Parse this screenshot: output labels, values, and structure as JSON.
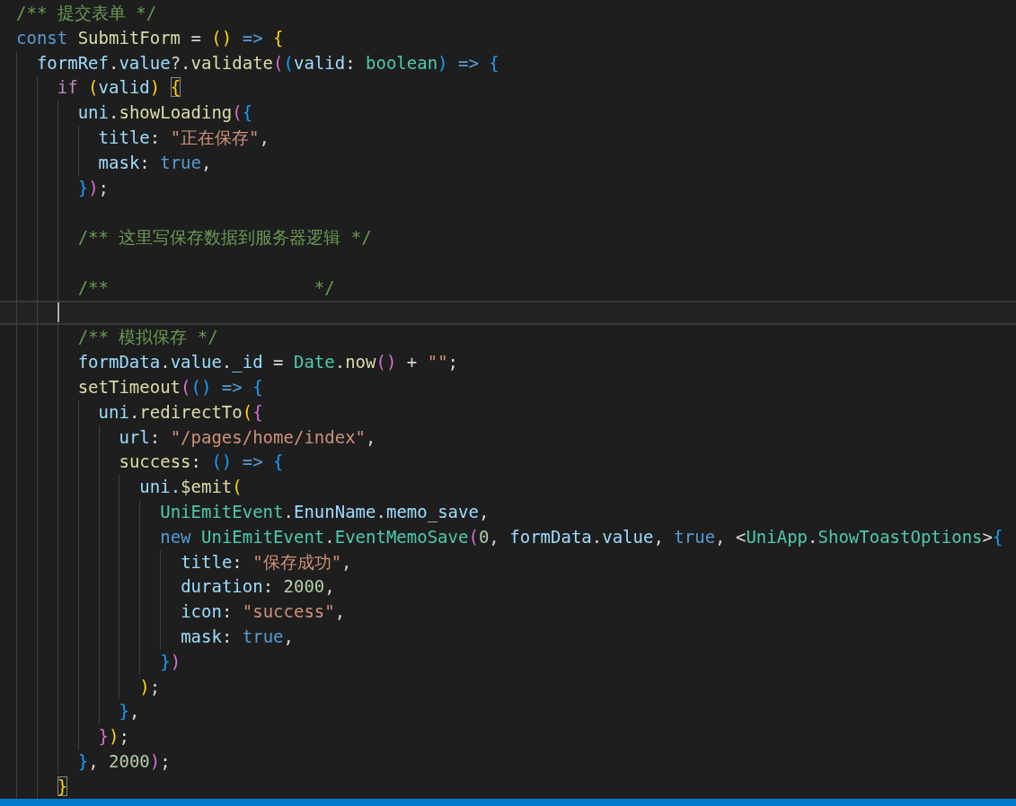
{
  "lines": [
    {
      "current": false,
      "tokens": [
        {
          "text": "/** 提交表单 */",
          "kind": "comment"
        }
      ]
    },
    {
      "current": false,
      "tokens": [
        {
          "text": "const ",
          "kind": "keyword"
        },
        {
          "text": "SubmitForm",
          "kind": "function"
        },
        {
          "text": " = ",
          "kind": "plain"
        },
        {
          "text": "()",
          "kind": "brace1"
        },
        {
          "text": " => ",
          "kind": "keyword"
        },
        {
          "text": "{",
          "kind": "brace1"
        }
      ]
    },
    {
      "current": false,
      "tokens": [
        {
          "text": "  formRef",
          "kind": "variable"
        },
        {
          "text": ".",
          "kind": "plain"
        },
        {
          "text": "value",
          "kind": "variable"
        },
        {
          "text": "?.",
          "kind": "plain"
        },
        {
          "text": "validate",
          "kind": "function"
        },
        {
          "text": "(",
          "kind": "brace2"
        },
        {
          "text": "(",
          "kind": "brace3"
        },
        {
          "text": "valid",
          "kind": "variable"
        },
        {
          "text": ": ",
          "kind": "plain"
        },
        {
          "text": "boolean",
          "kind": "type"
        },
        {
          "text": ")",
          "kind": "brace3"
        },
        {
          "text": " => ",
          "kind": "keyword"
        },
        {
          "text": "{",
          "kind": "brace3"
        }
      ]
    },
    {
      "current": false,
      "tokens": [
        {
          "text": "    if ",
          "kind": "control"
        },
        {
          "text": "(",
          "kind": "brace1"
        },
        {
          "text": "valid",
          "kind": "variable"
        },
        {
          "text": ") ",
          "kind": "brace1"
        },
        {
          "text": "{",
          "kind": "brace1",
          "matched": true
        }
      ]
    },
    {
      "current": false,
      "tokens": [
        {
          "text": "      uni",
          "kind": "variable"
        },
        {
          "text": ".",
          "kind": "plain"
        },
        {
          "text": "showLoading",
          "kind": "function"
        },
        {
          "text": "(",
          "kind": "brace2"
        },
        {
          "text": "{",
          "kind": "brace3"
        }
      ]
    },
    {
      "current": false,
      "tokens": [
        {
          "text": "        title",
          "kind": "variable"
        },
        {
          "text": ": ",
          "kind": "plain"
        },
        {
          "text": "\"正在保存\"",
          "kind": "string"
        },
        {
          "text": ",",
          "kind": "plain"
        }
      ]
    },
    {
      "current": false,
      "tokens": [
        {
          "text": "        mask",
          "kind": "variable"
        },
        {
          "text": ": ",
          "kind": "plain"
        },
        {
          "text": "true",
          "kind": "keyword"
        },
        {
          "text": ",",
          "kind": "plain"
        }
      ]
    },
    {
      "current": false,
      "tokens": [
        {
          "text": "      }",
          "kind": "brace3"
        },
        {
          "text": ")",
          "kind": "brace2"
        },
        {
          "text": ";",
          "kind": "plain"
        }
      ]
    },
    {
      "current": false
    },
    {
      "current": false,
      "tokens": [
        {
          "text": "      /** 这里写保存数据到服务器逻辑 */",
          "kind": "comment"
        }
      ]
    },
    {
      "current": false
    },
    {
      "current": false,
      "tokens": [
        {
          "text": "      /**                    */",
          "kind": "comment"
        }
      ]
    },
    {
      "current": true
    },
    {
      "current": false,
      "tokens": [
        {
          "text": "      /** 模拟保存 */",
          "kind": "comment"
        }
      ]
    },
    {
      "current": false,
      "tokens": [
        {
          "text": "      formData",
          "kind": "variable"
        },
        {
          "text": ".",
          "kind": "plain"
        },
        {
          "text": "value",
          "kind": "variable"
        },
        {
          "text": ".",
          "kind": "plain"
        },
        {
          "text": "_id",
          "kind": "variable"
        },
        {
          "text": " = ",
          "kind": "plain"
        },
        {
          "text": "Date",
          "kind": "type"
        },
        {
          "text": ".",
          "kind": "plain"
        },
        {
          "text": "now",
          "kind": "function"
        },
        {
          "text": "()",
          "kind": "brace2"
        },
        {
          "text": " + ",
          "kind": "plain"
        },
        {
          "text": "\"\"",
          "kind": "string"
        },
        {
          "text": ";",
          "kind": "plain"
        }
      ]
    },
    {
      "current": false,
      "tokens": [
        {
          "text": "      setTimeout",
          "kind": "function"
        },
        {
          "text": "(",
          "kind": "brace2"
        },
        {
          "text": "()",
          "kind": "brace3"
        },
        {
          "text": " => ",
          "kind": "keyword"
        },
        {
          "text": "{",
          "kind": "brace3"
        }
      ]
    },
    {
      "current": false,
      "tokens": [
        {
          "text": "        uni",
          "kind": "variable"
        },
        {
          "text": ".",
          "kind": "plain"
        },
        {
          "text": "redirectTo",
          "kind": "function"
        },
        {
          "text": "(",
          "kind": "brace1"
        },
        {
          "text": "{",
          "kind": "brace2"
        }
      ]
    },
    {
      "current": false,
      "tokens": [
        {
          "text": "          url",
          "kind": "variable"
        },
        {
          "text": ": ",
          "kind": "plain"
        },
        {
          "text": "\"/pages/home/index\"",
          "kind": "string"
        },
        {
          "text": ",",
          "kind": "plain"
        }
      ]
    },
    {
      "current": false,
      "tokens": [
        {
          "text": "          success",
          "kind": "function"
        },
        {
          "text": ": ",
          "kind": "plain"
        },
        {
          "text": "()",
          "kind": "brace3"
        },
        {
          "text": " => ",
          "kind": "keyword"
        },
        {
          "text": "{",
          "kind": "brace3"
        }
      ]
    },
    {
      "current": false,
      "tokens": [
        {
          "text": "            uni.",
          "kind": "variable"
        },
        {
          "text": "$emit",
          "kind": "function"
        },
        {
          "text": "(",
          "kind": "brace1"
        }
      ]
    },
    {
      "current": false,
      "tokens": [
        {
          "text": "              UniEmitEvent",
          "kind": "type"
        },
        {
          "text": ".",
          "kind": "plain"
        },
        {
          "text": "EnunName",
          "kind": "variable"
        },
        {
          "text": ".",
          "kind": "plain"
        },
        {
          "text": "memo_save",
          "kind": "variable"
        },
        {
          "text": ",",
          "kind": "plain"
        }
      ]
    },
    {
      "current": false,
      "tokens": [
        {
          "text": "              new ",
          "kind": "keyword"
        },
        {
          "text": "UniEmitEvent",
          "kind": "type"
        },
        {
          "text": ".",
          "kind": "plain"
        },
        {
          "text": "EventMemoSave",
          "kind": "type"
        },
        {
          "text": "(",
          "kind": "brace2"
        },
        {
          "text": "0",
          "kind": "number"
        },
        {
          "text": ", ",
          "kind": "plain"
        },
        {
          "text": "formData",
          "kind": "variable"
        },
        {
          "text": ".",
          "kind": "plain"
        },
        {
          "text": "value",
          "kind": "variable"
        },
        {
          "text": ", ",
          "kind": "plain"
        },
        {
          "text": "true",
          "kind": "keyword"
        },
        {
          "text": ", <",
          "kind": "plain"
        },
        {
          "text": "UniApp",
          "kind": "type"
        },
        {
          "text": ".",
          "kind": "plain"
        },
        {
          "text": "ShowToastOptions",
          "kind": "type"
        },
        {
          "text": ">",
          "kind": "plain"
        },
        {
          "text": "{",
          "kind": "brace3"
        }
      ]
    },
    {
      "current": false,
      "tokens": [
        {
          "text": "                title",
          "kind": "variable"
        },
        {
          "text": ": ",
          "kind": "plain"
        },
        {
          "text": "\"保存成功\"",
          "kind": "string"
        },
        {
          "text": ",",
          "kind": "plain"
        }
      ]
    },
    {
      "current": false,
      "tokens": [
        {
          "text": "                duration",
          "kind": "variable"
        },
        {
          "text": ": ",
          "kind": "plain"
        },
        {
          "text": "2000",
          "kind": "number"
        },
        {
          "text": ",",
          "kind": "plain"
        }
      ]
    },
    {
      "current": false,
      "tokens": [
        {
          "text": "                icon",
          "kind": "variable"
        },
        {
          "text": ": ",
          "kind": "plain"
        },
        {
          "text": "\"success\"",
          "kind": "string"
        },
        {
          "text": ",",
          "kind": "plain"
        }
      ]
    },
    {
      "current": false,
      "tokens": [
        {
          "text": "                mask",
          "kind": "variable"
        },
        {
          "text": ": ",
          "kind": "plain"
        },
        {
          "text": "true",
          "kind": "keyword"
        },
        {
          "text": ",",
          "kind": "plain"
        }
      ]
    },
    {
      "current": false,
      "tokens": [
        {
          "text": "              }",
          "kind": "brace3"
        },
        {
          "text": ")",
          "kind": "brace2"
        }
      ]
    },
    {
      "current": false,
      "tokens": [
        {
          "text": "            )",
          "kind": "brace1"
        },
        {
          "text": ";",
          "kind": "plain"
        }
      ]
    },
    {
      "current": false,
      "tokens": [
        {
          "text": "          }",
          "kind": "brace3"
        },
        {
          "text": ",",
          "kind": "plain"
        }
      ]
    },
    {
      "current": false,
      "tokens": [
        {
          "text": "        }",
          "kind": "brace2"
        },
        {
          "text": ")",
          "kind": "brace1"
        },
        {
          "text": ";",
          "kind": "plain"
        }
      ]
    },
    {
      "current": false,
      "tokens": [
        {
          "text": "      }",
          "kind": "brace3"
        },
        {
          "text": ", ",
          "kind": "plain"
        },
        {
          "text": "2000",
          "kind": "number"
        },
        {
          "text": ")",
          "kind": "brace2"
        },
        {
          "text": ";",
          "kind": "plain"
        }
      ]
    },
    {
      "current": false,
      "tokens": [
        {
          "text": "    }",
          "kind": "brace1",
          "matched": true
        }
      ]
    }
  ]
}
